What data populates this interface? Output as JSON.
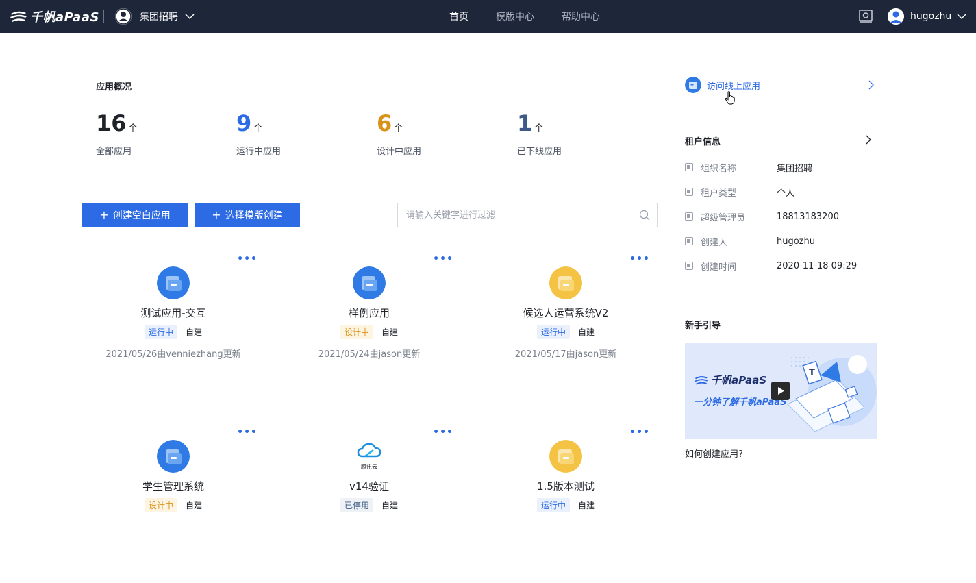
{
  "topbar": {
    "logo_text": "千帆aPaaS",
    "tenant_name": "集团招聘",
    "nav": [
      "首页",
      "模版中心",
      "帮助中心"
    ],
    "active_nav": 0,
    "user_name": "hugozhu",
    "bg_color": "#1e2639"
  },
  "overview": {
    "title": "应用概况",
    "stats": [
      {
        "value": "16",
        "unit": "个",
        "label": "全部应用",
        "color": "#1f2329"
      },
      {
        "value": "9",
        "unit": "个",
        "label": "运行中应用",
        "color": "#2d6be4"
      },
      {
        "value": "6",
        "unit": "个",
        "label": "设计中应用",
        "color": "#d8941a"
      },
      {
        "value": "1",
        "unit": "个",
        "label": "已下线应用",
        "color": "#3c5a85"
      }
    ]
  },
  "actions": {
    "create_blank": "创建空白应用",
    "create_from_template": "选择模版创建",
    "search_placeholder": "请输入关键字进行过滤"
  },
  "apps": [
    {
      "name": "测试应用-交互",
      "status": "运行中",
      "status_type": "run",
      "source": "自建",
      "updated": "2021/05/26由venniezhang更新",
      "icon": "blue-app-icon"
    },
    {
      "name": "样例应用",
      "status": "设计中",
      "status_type": "design",
      "source": "自建",
      "updated": "2021/05/24由jason更新",
      "icon": "blue-app-icon"
    },
    {
      "name": "候选人运营系统V2",
      "status": "运行中",
      "status_type": "run",
      "source": "自建",
      "updated": "2021/05/17由jason更新",
      "icon": "yellow-app-icon"
    },
    {
      "name": "学生管理系统",
      "status": "设计中",
      "status_type": "design",
      "source": "自建",
      "updated": "",
      "icon": "blue-app-icon"
    },
    {
      "name": "v14验证",
      "status": "已停用",
      "status_type": "stop",
      "source": "自建",
      "updated": "",
      "icon": "tencent-cloud-icon",
      "icon_label": "腾讯云"
    },
    {
      "name": "1.5版本测试",
      "status": "运行中",
      "status_type": "run",
      "source": "自建",
      "updated": "",
      "icon": "yellow-app-icon"
    }
  ],
  "more_label": "•••",
  "right": {
    "visit_label": "访问线上应用",
    "tenant_info_title": "租户信息",
    "tenant_info": [
      {
        "key": "组织名称",
        "value": "集团招聘"
      },
      {
        "key": "租户类型",
        "value": "个人"
      },
      {
        "key": "超级管理员",
        "value": "18813183200"
      },
      {
        "key": "创建人",
        "value": "hugozhu"
      },
      {
        "key": "创建时间",
        "value": "2020-11-18 09:29"
      }
    ],
    "guide_title": "新手引导",
    "guide_banner_logo": "千帆aPaaS",
    "guide_banner_subtitle": "一分钟了解千帆aPaaS",
    "guide_link": "如何创建应用?"
  },
  "colors": {
    "primary": "#2d6be4",
    "design": "#d8941a",
    "offline": "#3c5a85"
  }
}
